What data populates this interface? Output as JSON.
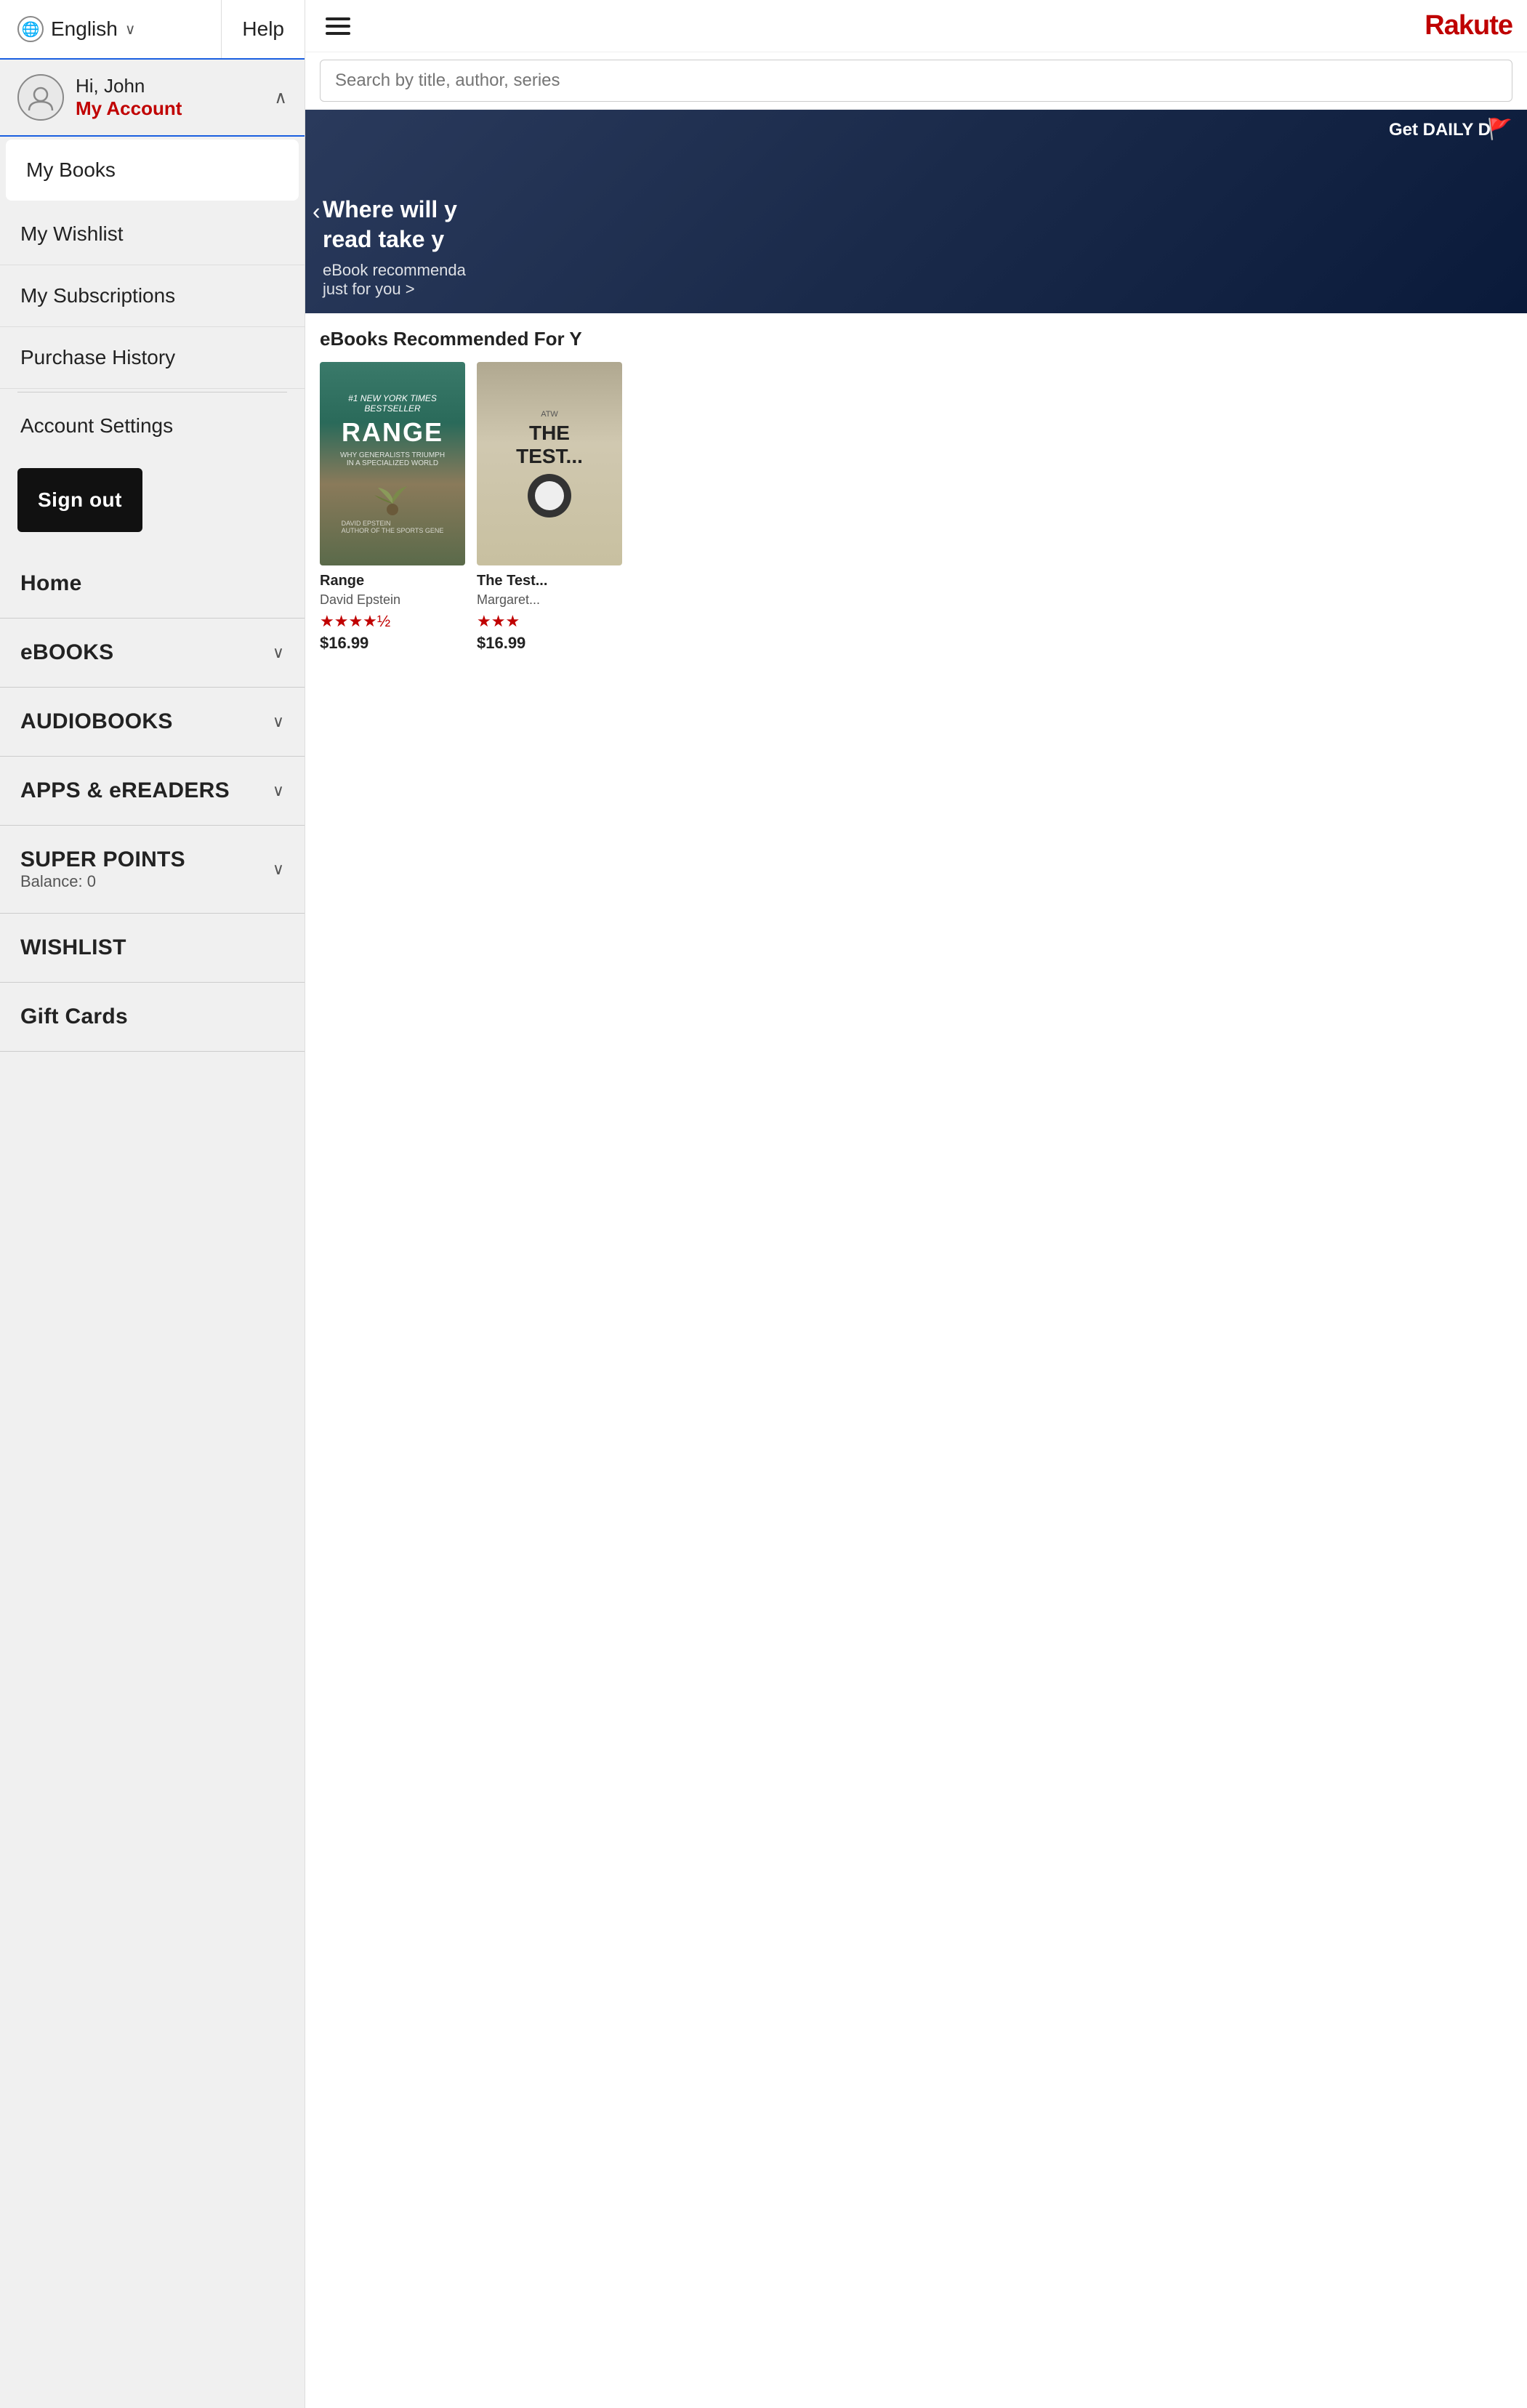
{
  "sidebar": {
    "language": {
      "label": "English",
      "chevron": "∨"
    },
    "help": {
      "label": "Help"
    },
    "account": {
      "greeting": "Hi, John",
      "link_label": "My Account",
      "chevron": "∧"
    },
    "menu_items": [
      {
        "label": "My Books",
        "active": true
      },
      {
        "label": "My Wishlist",
        "active": false
      },
      {
        "label": "My Subscriptions",
        "active": false
      },
      {
        "label": "Purchase History",
        "active": false
      }
    ],
    "account_settings_label": "Account Settings",
    "sign_out_label": "Sign out",
    "nav_items": [
      {
        "label": "Home",
        "has_chevron": false,
        "sub_label": ""
      },
      {
        "label": "eBOOKS",
        "has_chevron": true,
        "sub_label": ""
      },
      {
        "label": "AUDIOBOOKS",
        "has_chevron": true,
        "sub_label": ""
      },
      {
        "label": "APPS & eREADERS",
        "has_chevron": true,
        "sub_label": ""
      },
      {
        "label": "SUPER POINTS",
        "has_chevron": true,
        "sub_label": "Balance: 0"
      },
      {
        "label": "WISHLIST",
        "has_chevron": false,
        "sub_label": ""
      },
      {
        "label": "Gift Cards",
        "has_chevron": false,
        "sub_label": ""
      }
    ]
  },
  "main": {
    "header": {
      "logo": "Rakute"
    },
    "search": {
      "placeholder": "Search by title, author, series"
    },
    "banner": {
      "get_daily": "Get DAILY D",
      "headline": "Where will y\nread take y",
      "sub": "eBook recommenda\njust for you >"
    },
    "recommendations": {
      "title": "eBooks Recommended For Y",
      "books": [
        {
          "title": "Range",
          "author": "David Epstein",
          "stars": "★★★★½",
          "price": "$16.99",
          "badge": "#1 NEW YORK TIMES BESTSELLER",
          "cover_title": "RANGE",
          "cover_sub": "WHY GENERALISTS TRIUMPH\nIN A SPECIALIZED WORLD",
          "cover_author": "DAVID EPSTEIN\nAUTHOR OF THE SPORTS GENE"
        },
        {
          "title": "The Test...",
          "author": "Margaret...",
          "stars": "★★★",
          "price": "$16.99"
        }
      ]
    }
  }
}
